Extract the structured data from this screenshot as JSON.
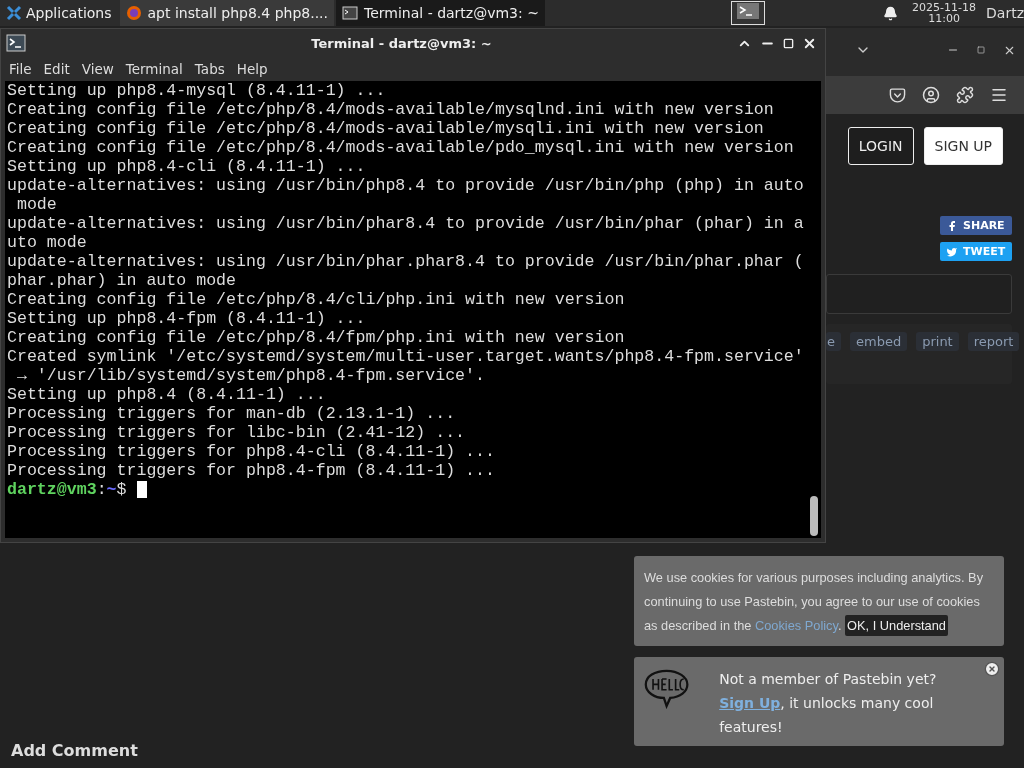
{
  "taskbar": {
    "menu_label": "Applications",
    "tasks": [
      {
        "kind": "browser",
        "label": "apt install php8.4 php8....",
        "selected": false
      },
      {
        "kind": "terminal",
        "label": "Terminal - dartz@vm3: ~",
        "selected": true
      }
    ],
    "clock": {
      "date": "2025-11-18",
      "time": "11:00"
    },
    "user": "Dartz"
  },
  "browser": {
    "auth_buttons": [
      {
        "label": "LOGIN",
        "kind": "outline"
      },
      {
        "label": "SIGN UP",
        "kind": "solid"
      }
    ],
    "share_buttons": [
      {
        "label": "SHARE",
        "kind": "facebook"
      },
      {
        "label": "TWEET",
        "kind": "twitter"
      }
    ],
    "actions": [
      "e",
      "embed",
      "print",
      "report"
    ],
    "cookie_notice": {
      "text": "We use cookies for various purposes including analytics. By continuing to use Pastebin, you agree to our use of cookies as described in the ",
      "link": "Cookies Policy",
      "after": ".",
      "button": "OK, I Understand"
    },
    "signup_notice": {
      "before": "Not a member of Pastebin yet?",
      "link": "Sign Up",
      "after": ", it unlocks many cool features!"
    },
    "heading": "Add Comment"
  },
  "terminal": {
    "title": "Terminal - dartz@vm3: ~",
    "menu": [
      "File",
      "Edit",
      "View",
      "Terminal",
      "Tabs",
      "Help"
    ],
    "lines": [
      "Setting up php8.4-mysql (8.4.11-1) ...",
      "Creating config file /etc/php/8.4/mods-available/mysqlnd.ini with new version",
      "Creating config file /etc/php/8.4/mods-available/mysqli.ini with new version",
      "Creating config file /etc/php/8.4/mods-available/pdo_mysql.ini with new version",
      "Setting up php8.4-cli (8.4.11-1) ...",
      "update-alternatives: using /usr/bin/php8.4 to provide /usr/bin/php (php) in auto",
      " mode",
      "update-alternatives: using /usr/bin/phar8.4 to provide /usr/bin/phar (phar) in a",
      "uto mode",
      "update-alternatives: using /usr/bin/phar.phar8.4 to provide /usr/bin/phar.phar (",
      "phar.phar) in auto mode",
      "Creating config file /etc/php/8.4/cli/php.ini with new version",
      "Setting up php8.4-fpm (8.4.11-1) ...",
      "Creating config file /etc/php/8.4/fpm/php.ini with new version",
      "Created symlink '/etc/systemd/system/multi-user.target.wants/php8.4-fpm.service'",
      " → '/usr/lib/systemd/system/php8.4-fpm.service'.",
      "Setting up php8.4 (8.4.11-1) ...",
      "Processing triggers for man-db (2.13.1-1) ...",
      "Processing triggers for libc-bin (2.41-12) ...",
      "Processing triggers for php8.4-cli (8.4.11-1) ...",
      "Processing triggers for php8.4-fpm (8.4.11-1) ..."
    ],
    "prompt": {
      "user": "dartz@vm3",
      "sep": ":",
      "path": "~",
      "symbol": "$"
    }
  }
}
